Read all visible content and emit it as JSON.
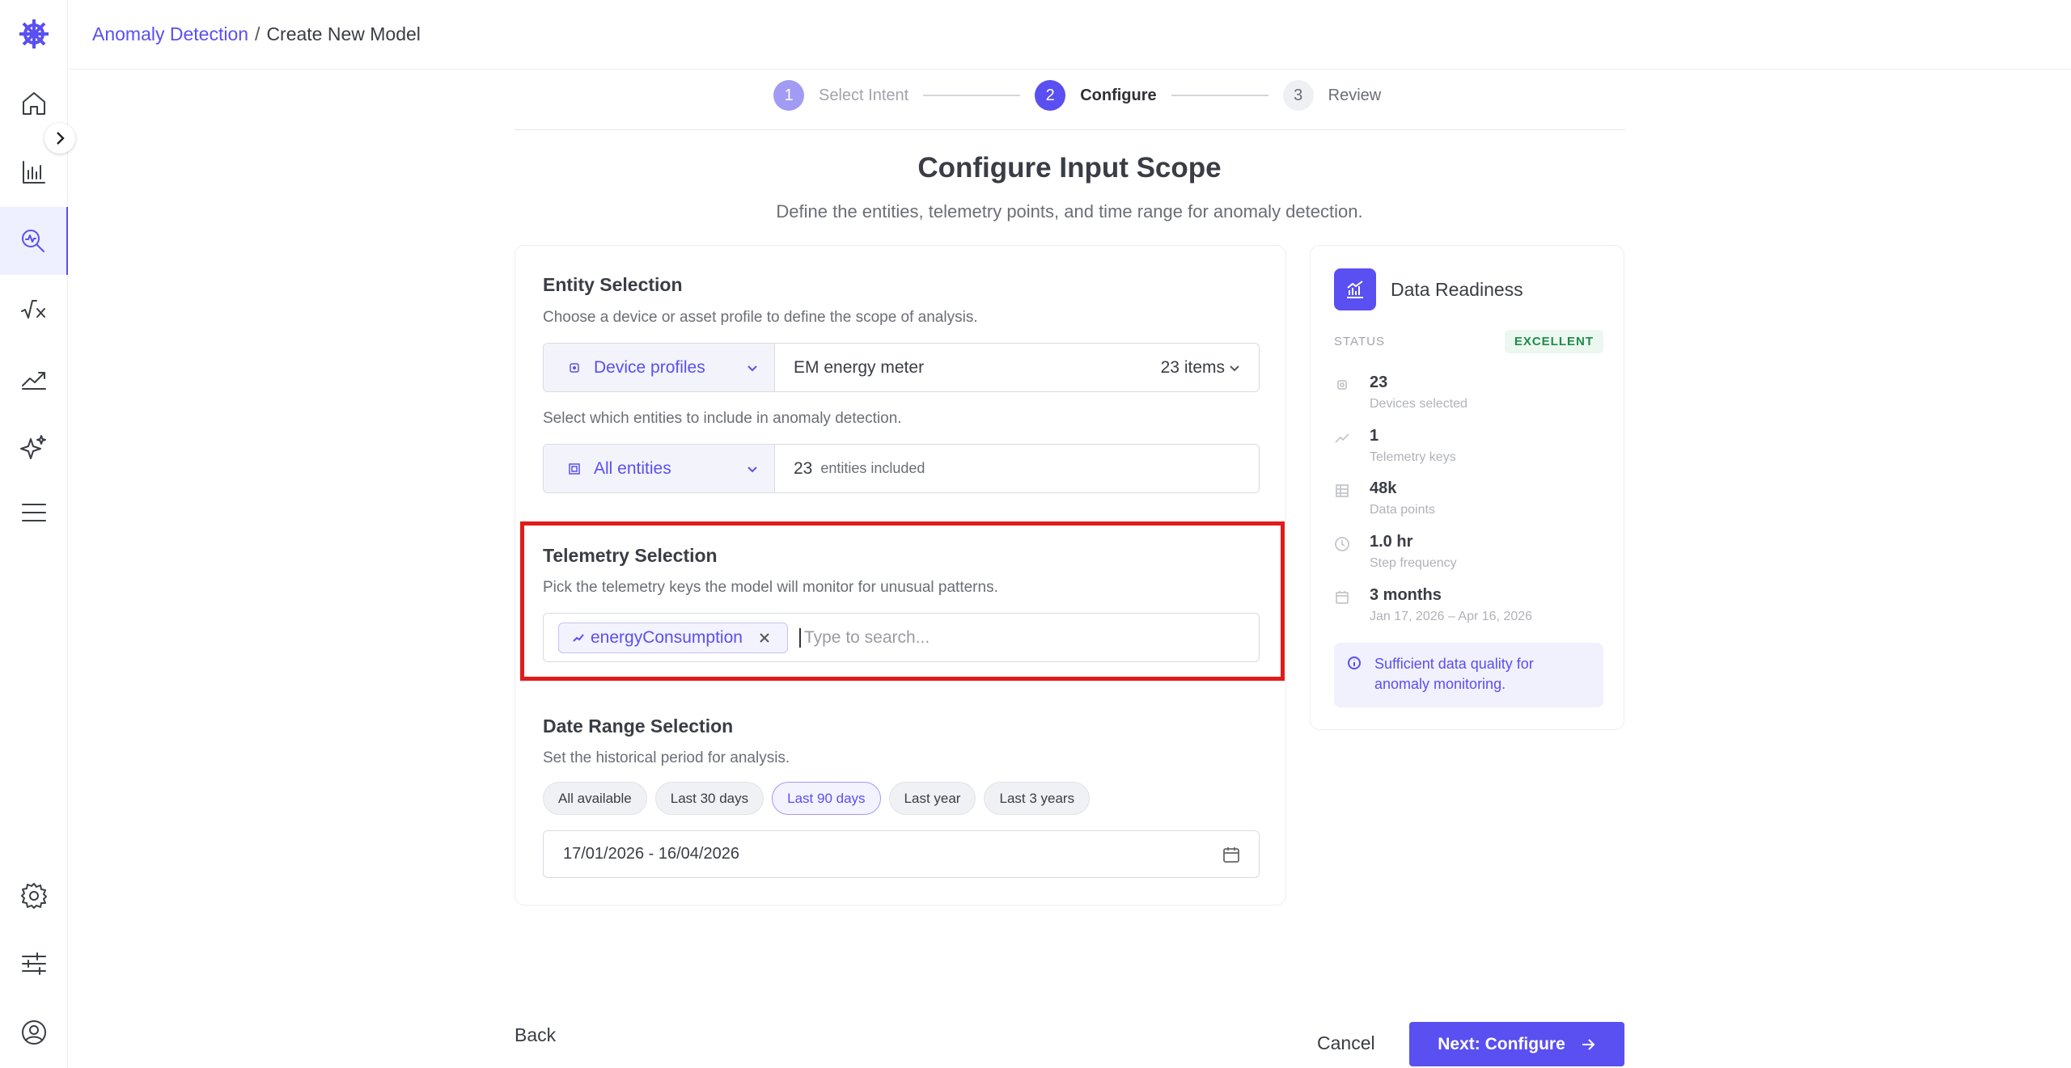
{
  "breadcrumb": {
    "link": "Anomaly Detection",
    "separator": "/",
    "current": "Create New Model"
  },
  "stepper": {
    "steps": [
      {
        "num": "1",
        "label": "Select Intent",
        "state": "done"
      },
      {
        "num": "2",
        "label": "Configure",
        "state": "active"
      },
      {
        "num": "3",
        "label": "Review",
        "state": "todo"
      }
    ]
  },
  "page": {
    "title": "Configure Input Scope",
    "subtitle": "Define the entities, telemetry points, and time range for anomaly detection."
  },
  "entity_selection": {
    "title": "Entity Selection",
    "desc": "Choose a device or asset profile to define the scope of analysis.",
    "profile_type": "Device profiles",
    "profile_value": "EM energy meter",
    "profile_count": "23 items",
    "include_desc": "Select which entities to include in anomaly detection.",
    "entities_type": "All entities",
    "entities_count": "23",
    "entities_suffix": "entities included"
  },
  "telemetry_selection": {
    "title": "Telemetry Selection",
    "desc": "Pick the telemetry keys the model will monitor for unusual patterns.",
    "chip": "energyConsumption",
    "search_placeholder": "Type to search..."
  },
  "date_range": {
    "title": "Date Range Selection",
    "desc": "Set the historical period for analysis.",
    "presets": [
      "All available",
      "Last 30 days",
      "Last 90 days",
      "Last year",
      "Last 3 years"
    ],
    "active_preset": "Last 90 days",
    "value": "17/01/2026 - 16/04/2026"
  },
  "readiness": {
    "title": "Data Readiness",
    "status_label": "STATUS",
    "status_value": "EXCELLENT",
    "metrics": [
      {
        "value": "23",
        "label": "Devices selected",
        "icon": "chip-icon"
      },
      {
        "value": "1",
        "label": "Telemetry keys",
        "icon": "trend-icon"
      },
      {
        "value": "48k",
        "label": "Data points",
        "icon": "grid-icon"
      },
      {
        "value": "1.0 hr",
        "label": "Step frequency",
        "icon": "clock-icon"
      },
      {
        "value": "3 months",
        "label": "Jan 17, 2026 – Apr 16, 2026",
        "icon": "calendar-icon"
      }
    ],
    "info": "Sufficient data quality for anomaly monitoring."
  },
  "footer": {
    "back": "Back",
    "cancel": "Cancel",
    "next": "Next: Configure"
  },
  "colors": {
    "accent": "#5a4ff0",
    "highlight": "#e11b1b",
    "success": "#1f8a4c"
  }
}
